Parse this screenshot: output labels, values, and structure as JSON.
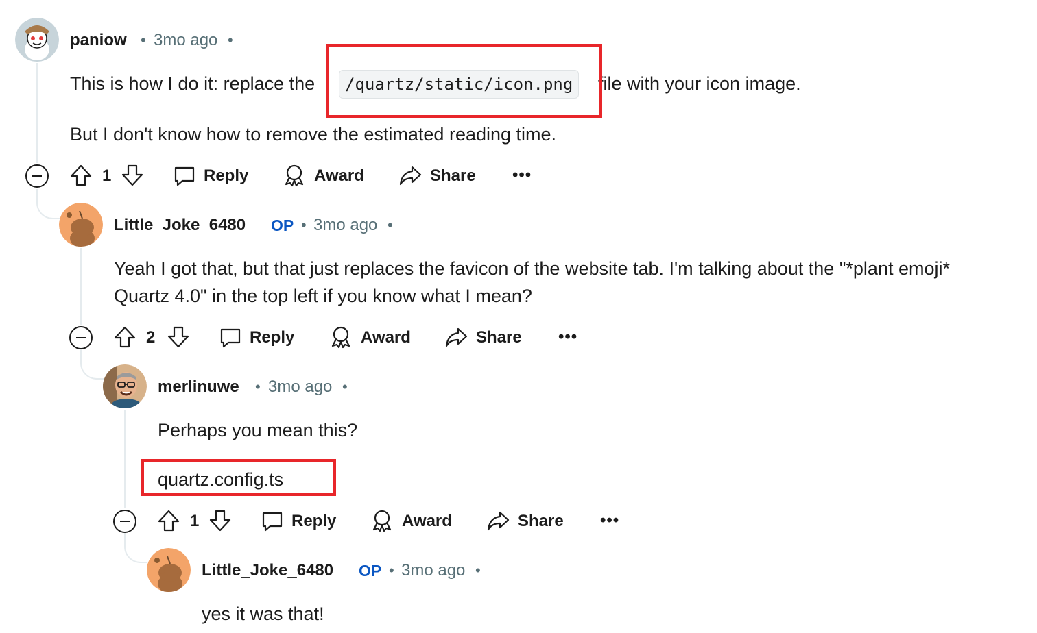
{
  "comments": [
    {
      "username": "paniow",
      "op_badge": "",
      "time": "3mo ago",
      "body_line_1a": "This is how I do it: replace the",
      "body_code": "/quartz/static/icon.png",
      "body_line_1b": "file with your icon image.",
      "body_line_2": "But I don't know how to remove the estimated reading time.",
      "votes": "1"
    },
    {
      "username": "Little_Joke_6480",
      "op_badge": "OP",
      "time": "3mo ago",
      "body_line_1": "Yeah I got that, but that just replaces the favicon of the website tab. I'm talking about the \"*plant emoji*",
      "body_line_2": "Quartz 4.0\" in the top left if you know what I mean?",
      "votes": "2"
    },
    {
      "username": "merlinuwe",
      "op_badge": "",
      "time": "3mo ago",
      "body_line_1": "Perhaps you mean this?",
      "body_line_2": "quartz.config.ts",
      "votes": "1"
    },
    {
      "username": "Little_Joke_6480",
      "op_badge": "OP",
      "time": "3mo ago",
      "body_line_1": "yes it was that!"
    }
  ],
  "actions": {
    "reply": "Reply",
    "award": "Award",
    "share": "Share",
    "more": "•••"
  },
  "separator": "•",
  "colors": {
    "accent_op": "#0a56c2",
    "meta_text": "#576f76",
    "highlight_box": "#e8262a",
    "thread_line": "#e5ebee"
  }
}
